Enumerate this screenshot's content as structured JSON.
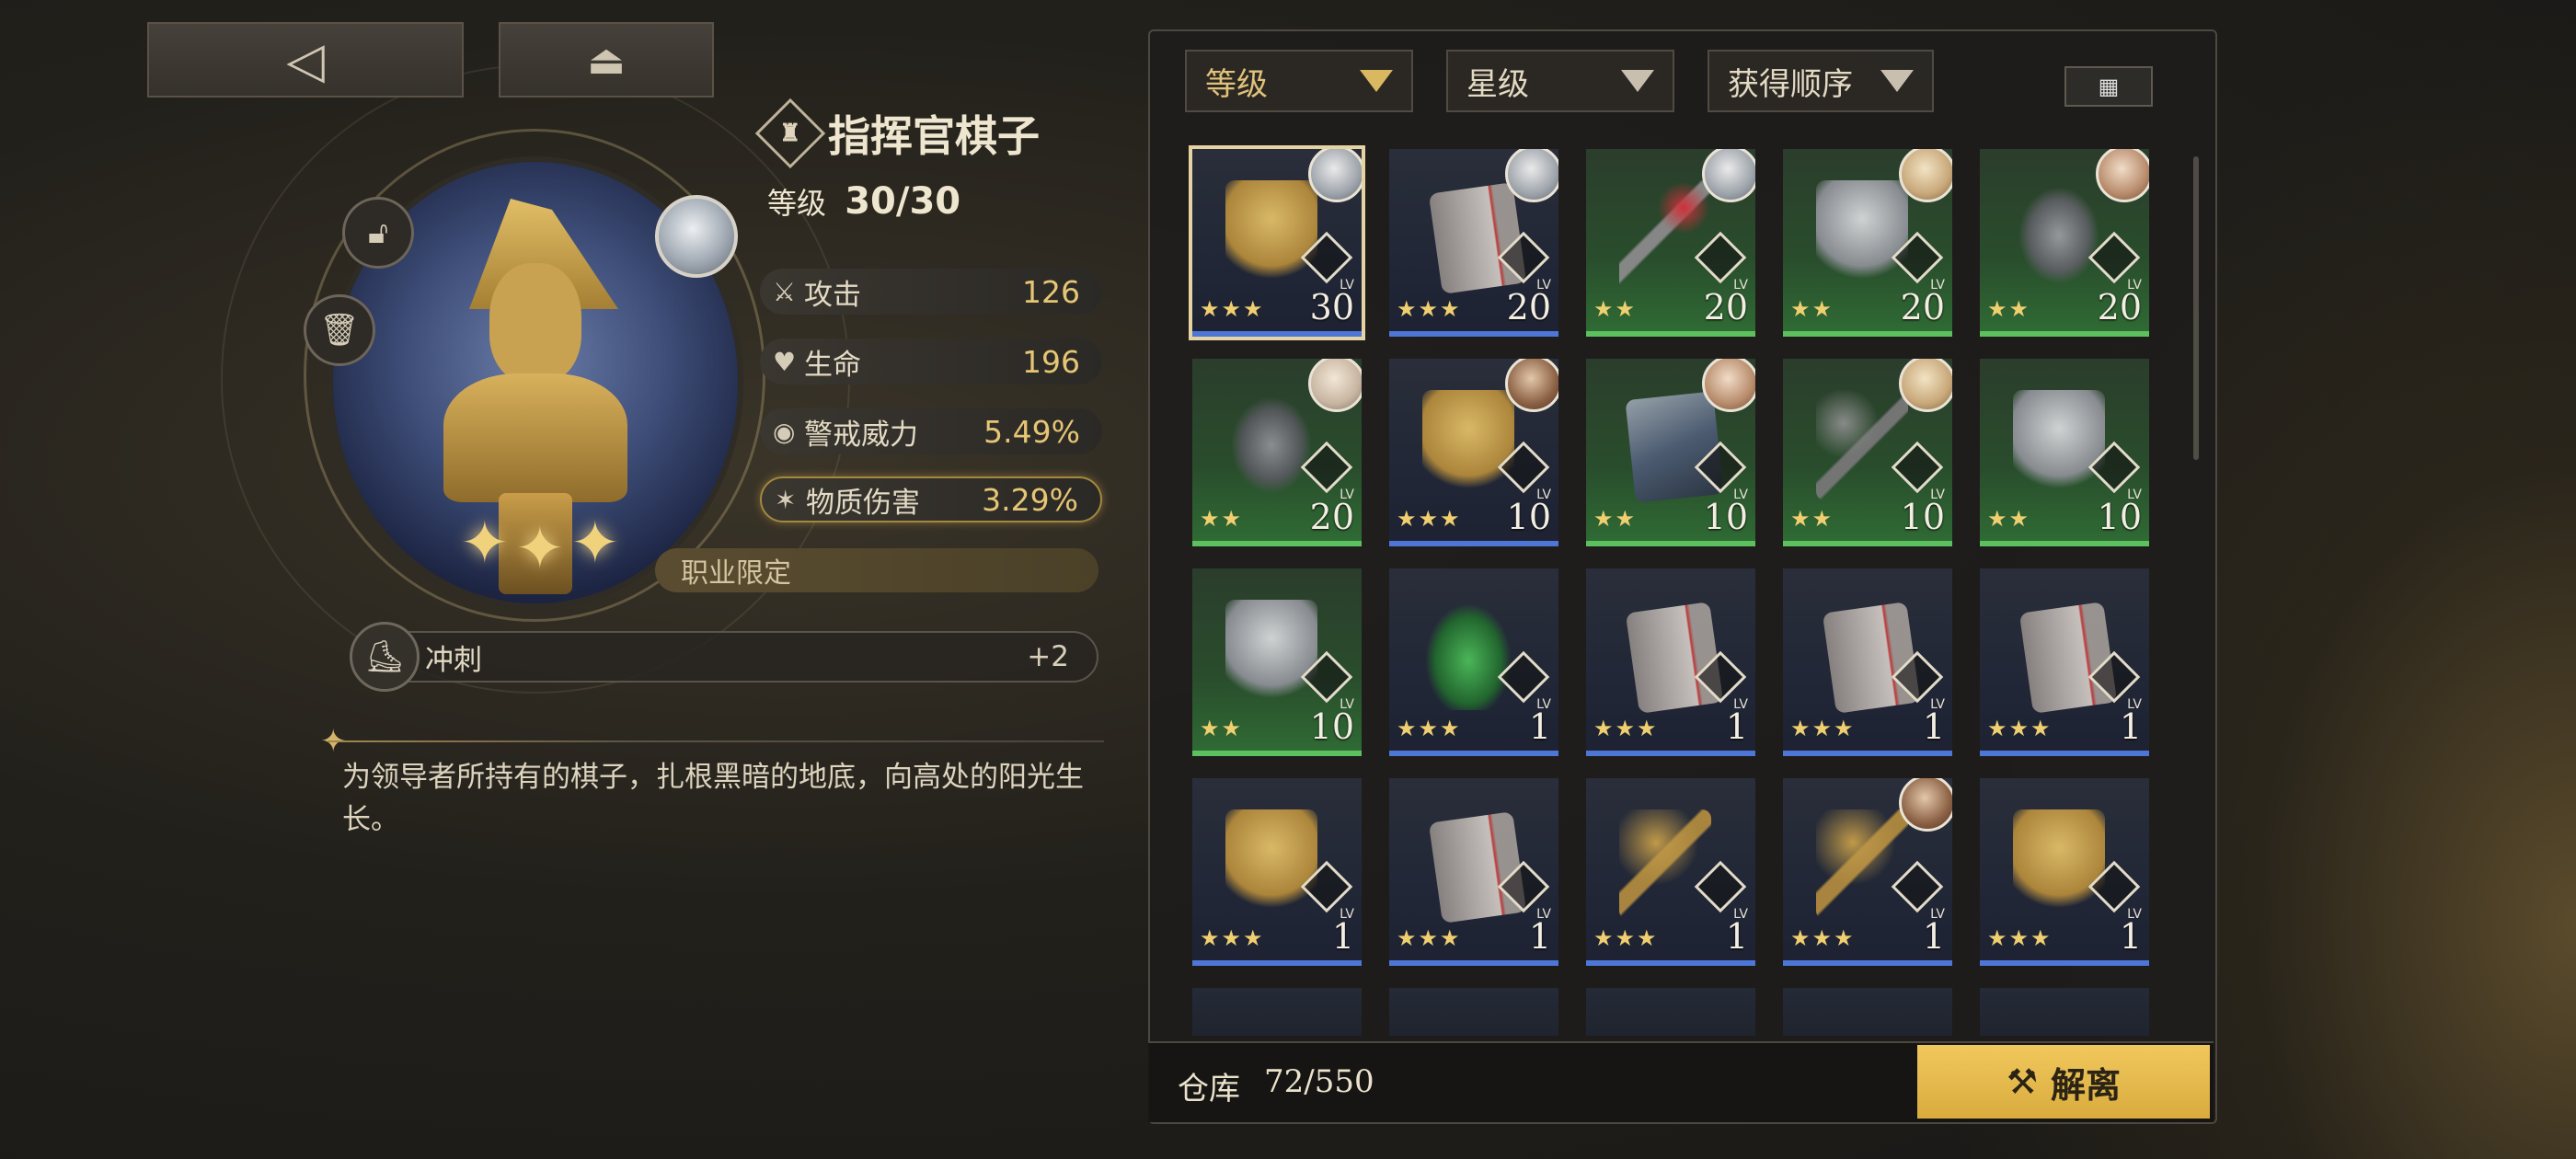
{
  "top": {
    "back_icon": "back-arrow-icon",
    "home_icon": "home-icon"
  },
  "item": {
    "name": "指挥官棋子",
    "level_label": "等级",
    "level": "30/30",
    "stats": [
      {
        "icon": "sword-icon",
        "name": "攻击",
        "value": "126"
      },
      {
        "icon": "heart-icon",
        "name": "生命",
        "value": "196"
      },
      {
        "icon": "eye-icon",
        "name": "警戒威力",
        "value": "5.49%"
      },
      {
        "icon": "claw-icon",
        "name": "物质伤害",
        "value": "3.29%"
      }
    ],
    "job_restriction": "职业限定",
    "skill": {
      "name": "冲刺",
      "value": "+2"
    },
    "description": "为领导者所持有的棋子，扎根黑暗的地底，向高处的阳光生长。",
    "stars": 3
  },
  "filters": [
    {
      "label": "等级",
      "active": true
    },
    {
      "label": "星级",
      "active": false
    },
    {
      "label": "获得顺序",
      "active": false
    }
  ],
  "grid": [
    {
      "lv": "30",
      "stars": "★★★",
      "rarity": "blue",
      "kind": "gold",
      "avatar": "a1",
      "selected": true
    },
    {
      "lv": "20",
      "stars": "★★★",
      "rarity": "blue",
      "kind": "book",
      "avatar": "a1"
    },
    {
      "lv": "20",
      "stars": "★★",
      "rarity": "green",
      "kind": "redkey",
      "avatar": "a1"
    },
    {
      "lv": "20",
      "stars": "★★",
      "rarity": "green",
      "kind": "silver",
      "avatar": "a2"
    },
    {
      "lv": "20",
      "stars": "★★",
      "rarity": "green",
      "kind": "bird",
      "avatar": "a3"
    },
    {
      "lv": "20",
      "stars": "★★",
      "rarity": "green",
      "kind": "wolf",
      "avatar": "a4"
    },
    {
      "lv": "10",
      "stars": "★★★",
      "rarity": "blue",
      "kind": "gold",
      "avatar": "a5"
    },
    {
      "lv": "10",
      "stars": "★★",
      "rarity": "green",
      "kind": "painting",
      "avatar": "a3"
    },
    {
      "lv": "10",
      "stars": "★★",
      "rarity": "green",
      "kind": "keypad",
      "avatar": "a2"
    },
    {
      "lv": "10",
      "stars": "★★",
      "rarity": "green",
      "kind": "silver",
      "avatar": ""
    },
    {
      "lv": "10",
      "stars": "★★",
      "rarity": "green",
      "kind": "silver",
      "avatar": ""
    },
    {
      "lv": "1",
      "stars": "★★★",
      "rarity": "blue",
      "kind": "crown",
      "avatar": ""
    },
    {
      "lv": "1",
      "stars": "★★★",
      "rarity": "blue",
      "kind": "book",
      "avatar": ""
    },
    {
      "lv": "1",
      "stars": "★★★",
      "rarity": "blue",
      "kind": "book",
      "avatar": ""
    },
    {
      "lv": "1",
      "stars": "★★★",
      "rarity": "blue",
      "kind": "book",
      "avatar": ""
    },
    {
      "lv": "1",
      "stars": "★★★",
      "rarity": "blue",
      "kind": "gold",
      "avatar": ""
    },
    {
      "lv": "1",
      "stars": "★★★",
      "rarity": "blue",
      "kind": "book",
      "avatar": ""
    },
    {
      "lv": "1",
      "stars": "★★★",
      "rarity": "blue",
      "kind": "key",
      "avatar": ""
    },
    {
      "lv": "1",
      "stars": "★★★",
      "rarity": "blue",
      "kind": "key",
      "avatar": "a5"
    },
    {
      "lv": "1",
      "stars": "★★★",
      "rarity": "blue",
      "kind": "gold",
      "avatar": ""
    }
  ],
  "lv_label": "LV",
  "footer": {
    "warehouse_label": "仓库",
    "warehouse_count": "72/550",
    "dismantle_label": "解离",
    "dismantle_icon": "wrench-icon"
  },
  "colors": {
    "accent": "#e5c05a",
    "blue_rarity": "#4d76d6",
    "green_rarity": "#5cc05f"
  }
}
